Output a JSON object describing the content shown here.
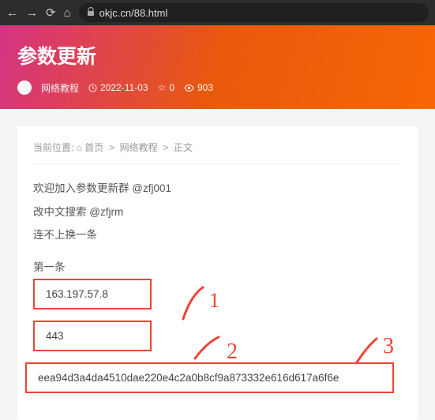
{
  "browser": {
    "url": "okjc.cn/88.html"
  },
  "header": {
    "title": "参数更新",
    "author": "网络教程",
    "date": "2022-11-03",
    "stars": "0",
    "views": "903"
  },
  "breadcrumb": {
    "label": "当前位置:",
    "home": "首页",
    "cat": "网络教程",
    "current": "正文",
    "sep": ">"
  },
  "body": {
    "line1": "欢迎加入参数更新群 @zfj001",
    "line2": "改中文搜索 @zfjrm",
    "line3": "连不上换一条"
  },
  "section": {
    "title": "第一条",
    "ip": "163.197.57.8",
    "port": "443",
    "key": "eea94d3a4da4510dae220e4c2a0b8cf9a873332e616d617a6f6e"
  },
  "annotations": {
    "n1": "1",
    "n2": "2",
    "n3": "3"
  }
}
